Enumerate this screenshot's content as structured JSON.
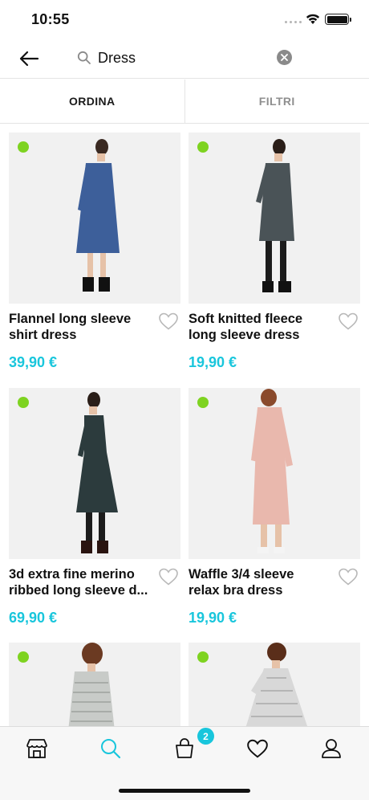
{
  "status_bar": {
    "time": "10:55"
  },
  "search": {
    "query": "Dress"
  },
  "toolbar": {
    "sort_label": "ORDINA",
    "filter_label": "FILTRI"
  },
  "products": [
    {
      "title": "Flannel long sleeve\nshirt dress",
      "price": "39,90 €",
      "available": true,
      "dress_color": "#3d5f9a"
    },
    {
      "title": "Soft knitted fleece\nlong sleeve dress",
      "price": "19,90 €",
      "available": true,
      "dress_color": "#4a5357"
    },
    {
      "title": "3d extra fine merino\nribbed long sleeve d...",
      "price": "69,90 €",
      "available": true,
      "dress_color": "#2c3b3d"
    },
    {
      "title": "Waffle 3/4 sleeve\nrelax bra dress",
      "price": "19,90 €",
      "available": true,
      "dress_color": "#e9b8ad"
    },
    {
      "title": "",
      "price": "",
      "available": true,
      "dress_color": "#c8cbc8"
    },
    {
      "title": "",
      "price": "",
      "available": true,
      "dress_color": "#d8d8d8"
    }
  ],
  "tab_bar": {
    "items": [
      "store-icon",
      "search-icon",
      "bag-icon",
      "heart-icon",
      "profile-icon"
    ],
    "active": "search-icon",
    "cart_count": "2"
  },
  "colors": {
    "accent": "#19c6dc",
    "available_dot": "#7ed321"
  }
}
